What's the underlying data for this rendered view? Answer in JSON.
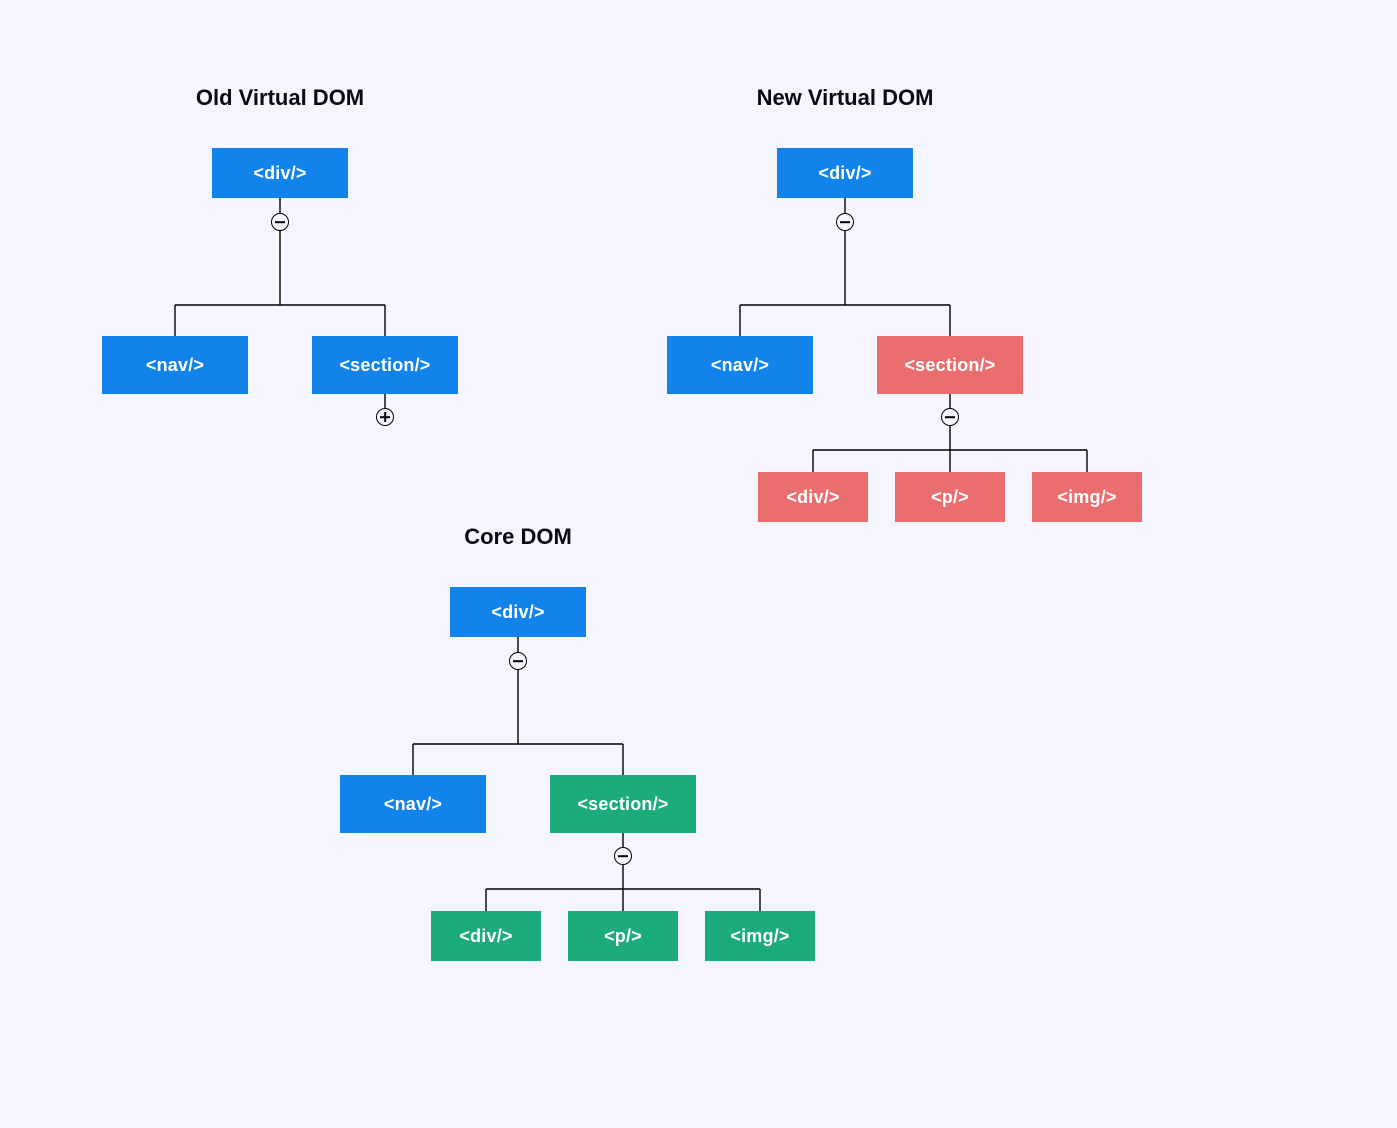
{
  "diagram": {
    "old": {
      "title": "Old Virtual DOM",
      "root": "<div/>",
      "nav": "<nav/>",
      "section": "<section/>"
    },
    "new": {
      "title": "New Virtual DOM",
      "root": "<div/>",
      "nav": "<nav/>",
      "section": "<section/>",
      "child_div": "<div/>",
      "child_p": "<p/>",
      "child_img": "<img/>"
    },
    "core": {
      "title": "Core DOM",
      "root": "<div/>",
      "nav": "<nav/>",
      "section": "<section/>",
      "child_div": "<div/>",
      "child_p": "<p/>",
      "child_img": "<img/>"
    }
  },
  "colors": {
    "unchanged": "#1283eb",
    "changed_new": "#eb6e6e",
    "applied_core": "#1cab7c",
    "background": "#f5f5ff"
  }
}
